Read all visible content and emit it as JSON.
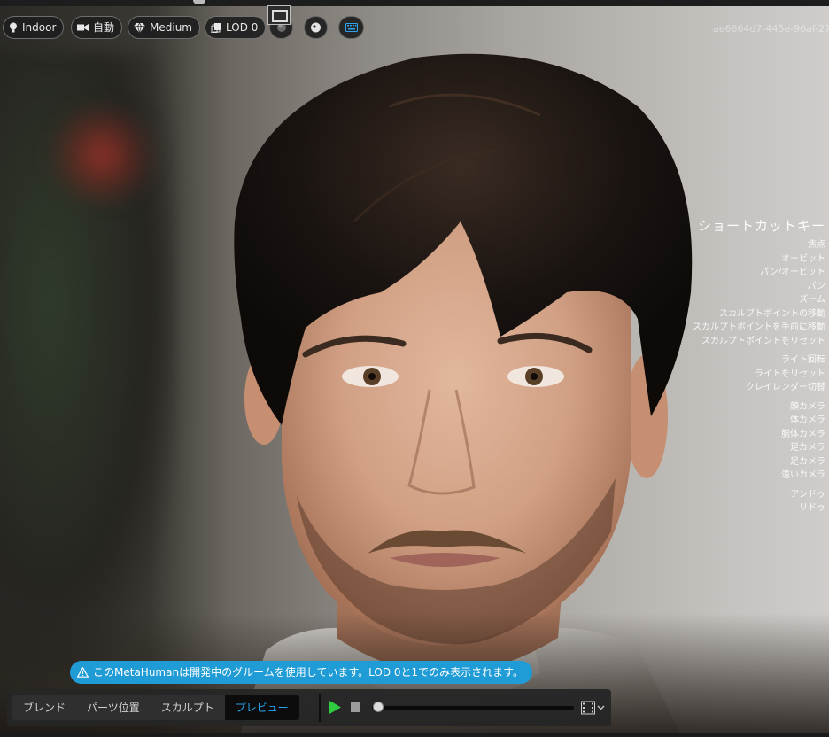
{
  "toolbar": {
    "lighting": "Indoor",
    "camera": "自動",
    "quality": "Medium",
    "lod": "LOD 0"
  },
  "asset_id": "ae6664d7-445e-96af-27",
  "shortcuts": {
    "title": "ショートカットキー",
    "group1": [
      "焦点",
      "オービット",
      "パン/オービット",
      "パン",
      "ズーム",
      "スカルプトポイントの移動",
      "スカルプトポイントを手前に移動",
      "スカルプトポイントをリセット"
    ],
    "group2": [
      "ライト回転",
      "ライトをリセット",
      "クレイレンダー切替"
    ],
    "group3": [
      "顔カメラ",
      "体カメラ",
      "胴体カメラ",
      "足カメラ",
      "足カメラ",
      "遠いカメラ"
    ],
    "group4": [
      "アンドゥ",
      "リドゥ"
    ]
  },
  "warning": "このMetaHumanは開発中のグルームを使用しています。LOD 0と1でのみ表示されます。",
  "tabs": {
    "blend": "ブレンド",
    "parts": "パーツ位置",
    "sculpt": "スカルプト",
    "preview": "プレビュー"
  },
  "timeline": {
    "progress": 0.0
  },
  "colors": {
    "accent": "#1f9bd6",
    "active_tab_text": "#27a6ee",
    "play": "#2ecc40"
  }
}
